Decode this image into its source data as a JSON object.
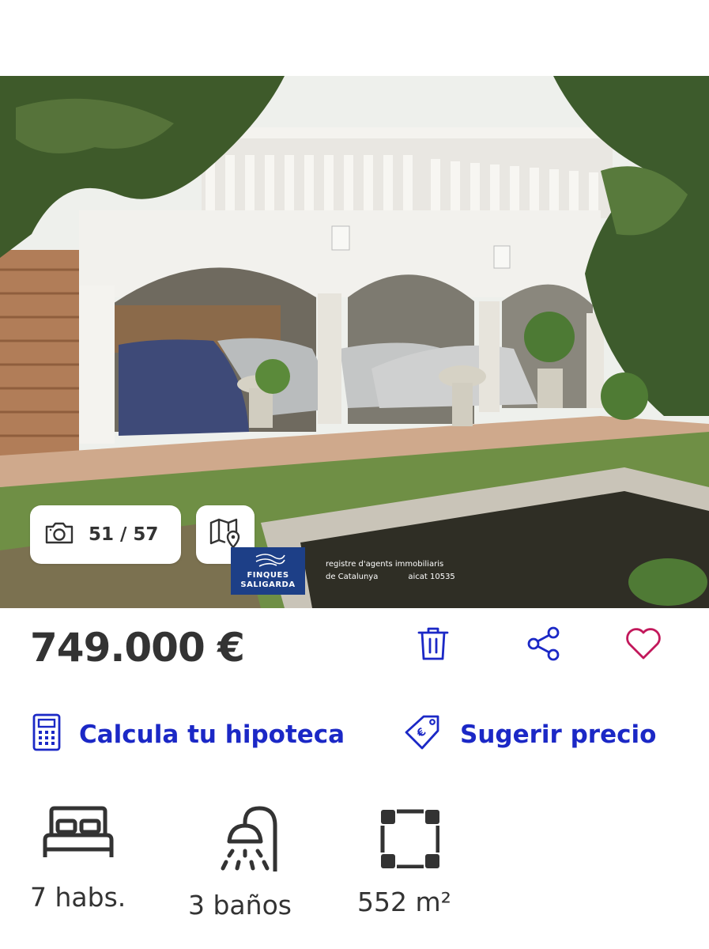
{
  "gallery": {
    "counter": "51 / 57",
    "agency_line1": "FINQUES",
    "agency_line2": "SALIGARDA",
    "registry_line1": "registre d'agents immobiliaris",
    "registry_line2a": "de Catalunya",
    "registry_line2b": "aicat 10535"
  },
  "listing": {
    "price": "749.000 €",
    "mortgage_link": "Calcula tu hipoteca",
    "suggest_price_link": "Sugerir precio"
  },
  "features": {
    "rooms": "7 habs.",
    "baths": "3 baños",
    "area": "552 m²"
  },
  "colors": {
    "accent": "#1b28c6",
    "favorite": "#c2185b",
    "text": "#333333",
    "watermark_bg": "#1d3f87"
  },
  "icons": {
    "camera": "camera-icon",
    "map": "map-pin-icon",
    "trash": "trash-icon",
    "share": "share-icon",
    "favorite": "heart-icon",
    "calculator": "calculator-icon",
    "price_tag": "price-tag-icon",
    "bed": "bed-icon",
    "shower": "shower-icon",
    "area": "area-icon"
  }
}
